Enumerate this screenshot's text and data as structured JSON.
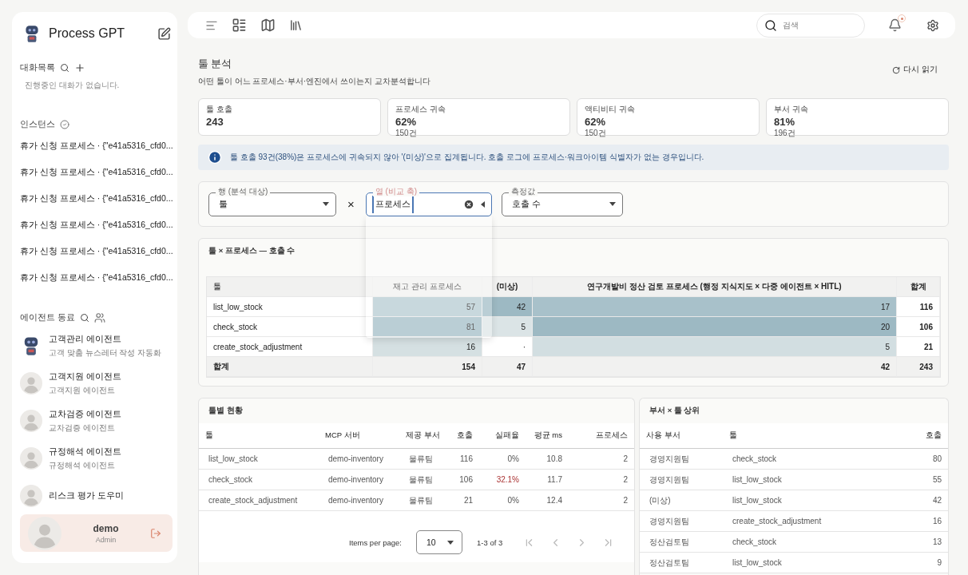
{
  "sidebar": {
    "app_name": "Process GPT",
    "conversations": {
      "title": "대화목록",
      "empty": "진행중인 대화가 없습니다."
    },
    "instances": {
      "title": "인스턴스",
      "items": [
        "휴가 신청 프로세스 · {\"e41a5316_cfd0...",
        "휴가 신청 프로세스 · {\"e41a5316_cfd0...",
        "휴가 신청 프로세스 · {\"e41a5316_cfd0...",
        "휴가 신청 프로세스 · {\"e41a5316_cfd0...",
        "휴가 신청 프로세스 · {\"e41a5316_cfd0...",
        "휴가 신청 프로세스 · {\"e41a5316_cfd0..."
      ]
    },
    "agents": {
      "title": "에이전트 동료",
      "items": [
        {
          "kind": "robot",
          "name": "고객관리 에이전트",
          "description": "고객 맞춤 뉴스레터 작성 자동화"
        },
        {
          "kind": "person",
          "name": "고객지원 에이전트",
          "description": "고객지원 에이전트"
        },
        {
          "kind": "person",
          "name": "교차검증 에이전트",
          "description": "교차검증 에이전트"
        },
        {
          "kind": "person",
          "name": "규정해석 에이전트",
          "description": "규정해석 에이전트"
        },
        {
          "kind": "person",
          "name": "리스크 평가 도우미"
        }
      ]
    },
    "user": {
      "name": "demo",
      "role": "Admin"
    }
  },
  "header": {
    "search": {
      "placeholder": "검색"
    }
  },
  "page": {
    "title": "툴 분석",
    "subtitle": "어떤 툴이 어느 프로세스·부서·엔진에서 쓰이는지 교차분석합니다",
    "reload": "다시 읽기"
  },
  "stats": [
    {
      "label": "툴 호출",
      "value": "243"
    },
    {
      "label": "프로세스 귀속",
      "value": "62%",
      "sub": "150건"
    },
    {
      "label": "액티비티 귀속",
      "value": "62%",
      "sub": "150건"
    },
    {
      "label": "부서 귀속",
      "value": "81%",
      "sub": "196건"
    }
  ],
  "info": "툴 호출 93건(38%)은 프로세스에 귀속되지 않아 '(미상)'으로 집계됩니다. 호출 로그에 프로세스·워크아이템 식별자가 없는 경우입니다.",
  "filters": [
    {
      "kind": "select",
      "label": "행 (분석 대상)",
      "value": "툴",
      "focused": false
    },
    {
      "kind": "separator",
      "text": "×"
    },
    {
      "kind": "autocomplete",
      "label": "열 (비교 축)",
      "value": "프로세스",
      "focused": true,
      "open": true
    },
    {
      "kind": "select",
      "label": "측정값",
      "value": "호출 수",
      "focused": false
    }
  ],
  "cross_table": {
    "title": "툴 × 프로세스 — 호출 수",
    "columns": [
      "툴",
      "재고 관리 프로세스",
      "(미상)",
      "연구개발비 정산 검토 프로세스 (행정 지식지도 × 다중 에이전트 × HITL)",
      "합계"
    ],
    "rows": [
      [
        "list_low_stock",
        "57",
        "42",
        "17",
        "116"
      ],
      [
        "check_stock",
        "81",
        "5",
        "20",
        "106"
      ],
      [
        "create_stock_adjustment",
        "16",
        "·",
        "5",
        "21"
      ]
    ],
    "total": [
      "합계",
      "154",
      "47",
      "42",
      "243"
    ]
  },
  "tool_table": {
    "title": "툴별 현황",
    "columns": [
      "툴",
      "MCP 서버",
      "제공 부서",
      "호출",
      "실패율",
      "평균 ms",
      "프로세스"
    ],
    "rows": [
      {
        "cells": [
          "list_low_stock",
          "demo-inventory",
          "물류팀",
          "116",
          "0%",
          "10.8",
          "2"
        ],
        "alert": false
      },
      {
        "cells": [
          "check_stock",
          "demo-inventory",
          "물류팀",
          "106",
          "32.1%",
          "11.7",
          "2"
        ],
        "alert": true
      },
      {
        "cells": [
          "create_stock_adjustment",
          "demo-inventory",
          "물류팀",
          "21",
          "0%",
          "12.4",
          "2"
        ],
        "alert": false
      }
    ],
    "pagination": {
      "label": "Items per page:",
      "per_page": "10",
      "range": "1-3 of 3"
    }
  },
  "dept_table": {
    "title": "부서 × 툴 상위",
    "columns": [
      "사용 부서",
      "툴",
      "호출"
    ],
    "rows": [
      [
        "경영지원팀",
        "check_stock",
        "80"
      ],
      [
        "경영지원팀",
        "list_low_stock",
        "55"
      ],
      [
        "(미상)",
        "list_low_stock",
        "42"
      ],
      [
        "경영지원팀",
        "create_stock_adjustment",
        "16"
      ],
      [
        "정산검토팀",
        "check_stock",
        "13"
      ],
      [
        "정산검토팀",
        "list_low_stock",
        "9"
      ]
    ]
  }
}
